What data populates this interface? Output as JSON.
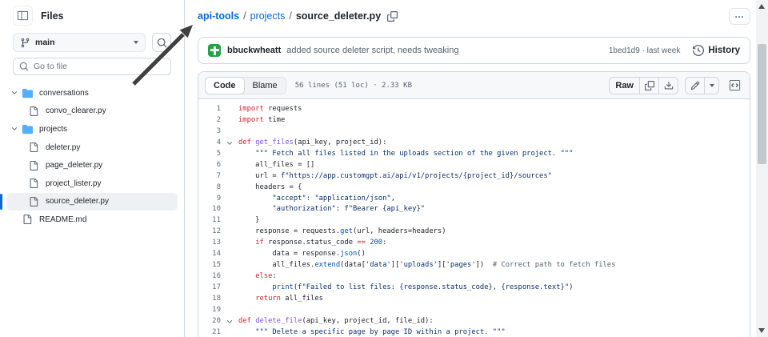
{
  "sidebar": {
    "title": "Files",
    "branch": "main",
    "goto_placeholder": "Go to file",
    "tree": [
      {
        "type": "folder",
        "level": 0,
        "label": "conversations",
        "expanded": true
      },
      {
        "type": "file",
        "level": 1,
        "label": "convo_clearer.py"
      },
      {
        "type": "folder",
        "level": 0,
        "label": "projects",
        "expanded": true
      },
      {
        "type": "file",
        "level": 1,
        "label": "deleter.py"
      },
      {
        "type": "file",
        "level": 1,
        "label": "page_deleter.py"
      },
      {
        "type": "file",
        "level": 1,
        "label": "project_lister.py"
      },
      {
        "type": "file",
        "level": 1,
        "label": "source_deleter.py",
        "selected": true
      },
      {
        "type": "file",
        "level": 0,
        "label": "README.md"
      }
    ]
  },
  "breadcrumb": {
    "repo": "api-tools",
    "dir": "projects",
    "file": "source_deleter.py"
  },
  "kebab_label": "…",
  "commit": {
    "author": "bbuckwheatt",
    "message": "added source deleter script, needs tweaking",
    "sha_and_time": "1bed1d9 · last week",
    "history_label": "History"
  },
  "code_header": {
    "tab_code": "Code",
    "tab_blame": "Blame",
    "meta": "56 lines (51 loc) · 2.33 KB",
    "raw_label": "Raw"
  },
  "code": {
    "language": "python",
    "lines": [
      {
        "n": 1,
        "tokens": [
          [
            "k",
            "import"
          ],
          [
            "p",
            " requests"
          ]
        ]
      },
      {
        "n": 2,
        "tokens": [
          [
            "k",
            "import"
          ],
          [
            "p",
            " time"
          ]
        ]
      },
      {
        "n": 3,
        "tokens": []
      },
      {
        "n": 4,
        "fold": true,
        "tokens": [
          [
            "k",
            "def"
          ],
          [
            "p",
            " "
          ],
          [
            "f",
            "get_files"
          ],
          [
            "p",
            "(api_key, project_id):"
          ]
        ]
      },
      {
        "n": 5,
        "tokens": [
          [
            "p",
            "    "
          ],
          [
            "s",
            "\"\"\" Fetch all files listed in the uploads section of the given project. \"\"\""
          ]
        ]
      },
      {
        "n": 6,
        "tokens": [
          [
            "p",
            "    all_files = []"
          ]
        ]
      },
      {
        "n": 7,
        "tokens": [
          [
            "p",
            "    url = "
          ],
          [
            "s",
            "f\"https://app.customgpt.ai/api/v1/projects/{project_id}/sources\""
          ]
        ]
      },
      {
        "n": 8,
        "tokens": [
          [
            "p",
            "    headers = {"
          ]
        ]
      },
      {
        "n": 9,
        "tokens": [
          [
            "p",
            "        "
          ],
          [
            "s",
            "\"accept\""
          ],
          [
            "p",
            ": "
          ],
          [
            "s",
            "\"application/json\""
          ],
          [
            "p",
            ","
          ]
        ]
      },
      {
        "n": 10,
        "tokens": [
          [
            "p",
            "        "
          ],
          [
            "s",
            "\"authorization\""
          ],
          [
            "p",
            ": "
          ],
          [
            "s",
            "f\"Bearer {api_key}\""
          ]
        ]
      },
      {
        "n": 11,
        "tokens": [
          [
            "p",
            "    }"
          ]
        ]
      },
      {
        "n": 12,
        "tokens": [
          [
            "p",
            "    response = requests."
          ],
          [
            "c",
            "get"
          ],
          [
            "p",
            "(url, headers=headers)"
          ]
        ]
      },
      {
        "n": 13,
        "tokens": [
          [
            "p",
            "    "
          ],
          [
            "k",
            "if"
          ],
          [
            "p",
            " response.status_code "
          ],
          [
            "k",
            "=="
          ],
          [
            "p",
            " "
          ],
          [
            "n",
            "200"
          ],
          [
            "p",
            ":"
          ]
        ]
      },
      {
        "n": 14,
        "tokens": [
          [
            "p",
            "        data = response."
          ],
          [
            "c",
            "json"
          ],
          [
            "p",
            "()"
          ]
        ]
      },
      {
        "n": 15,
        "tokens": [
          [
            "p",
            "        all_files."
          ],
          [
            "c",
            "extend"
          ],
          [
            "p",
            "(data["
          ],
          [
            "s",
            "'data'"
          ],
          [
            "p",
            "]["
          ],
          [
            "s",
            "'uploads'"
          ],
          [
            "p",
            "]["
          ],
          [
            "s",
            "'pages'"
          ],
          [
            "p",
            "])  "
          ],
          [
            "m",
            "# Correct path to fetch files"
          ]
        ]
      },
      {
        "n": 16,
        "tokens": [
          [
            "p",
            "    "
          ],
          [
            "k",
            "else"
          ],
          [
            "p",
            ":"
          ]
        ]
      },
      {
        "n": 17,
        "tokens": [
          [
            "p",
            "        "
          ],
          [
            "c",
            "print"
          ],
          [
            "p",
            "("
          ],
          [
            "s",
            "f\"Failed to list files: {response.status_code}, {response.text}\""
          ],
          [
            "p",
            ")"
          ]
        ]
      },
      {
        "n": 18,
        "tokens": [
          [
            "p",
            "    "
          ],
          [
            "k",
            "return"
          ],
          [
            "p",
            " all_files"
          ]
        ]
      },
      {
        "n": 19,
        "tokens": []
      },
      {
        "n": 20,
        "fold": true,
        "tokens": [
          [
            "k",
            "def"
          ],
          [
            "p",
            " "
          ],
          [
            "f",
            "delete_file"
          ],
          [
            "p",
            "(api_key, project_id, file_id):"
          ]
        ]
      },
      {
        "n": 21,
        "tokens": [
          [
            "p",
            "    "
          ],
          [
            "s",
            "\"\"\" Delete a specific page by page ID within a project. \"\"\""
          ]
        ]
      }
    ]
  },
  "colors": {
    "accent": "#0969da",
    "folder": "#54aeff",
    "avatar_green": "#26a148"
  }
}
